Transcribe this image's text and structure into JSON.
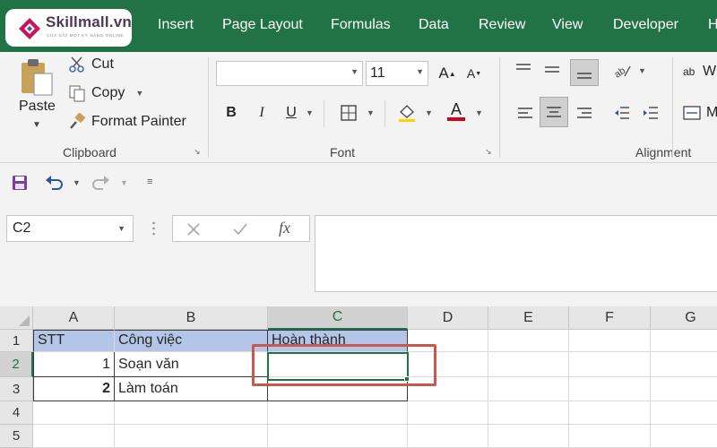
{
  "logo": {
    "name": "Skillmall.vn",
    "tagline": "CỬA GIỮ MỘT KỸ NĂNG ONLINE",
    "color": "#c2185b"
  },
  "ribbon_tabs": [
    "Insert",
    "Page Layout",
    "Formulas",
    "Data",
    "Review",
    "View",
    "Developer",
    "H"
  ],
  "clipboard": {
    "paste_label": "Paste",
    "cut_label": "Cut",
    "copy_label": "Copy",
    "format_painter_label": "Format Painter",
    "group_label": "Clipboard"
  },
  "font": {
    "font_name": "",
    "font_size": "11",
    "group_label": "Font",
    "bold": "B",
    "italic": "I",
    "underline": "U",
    "increase_size": "A",
    "decrease_size": "A",
    "font_color_letter": "A"
  },
  "alignment": {
    "group_label": "Alignment",
    "wrap_prefix": "ab",
    "wrap_label": "W",
    "merge_label": "M"
  },
  "name_box": "C2",
  "formula_value": "",
  "columns": [
    "A",
    "B",
    "C",
    "D",
    "E",
    "F",
    "G"
  ],
  "rows": [
    {
      "num": "1",
      "A": "STT",
      "B": "Công việc",
      "C": "Hoàn thành"
    },
    {
      "num": "2",
      "A": "1",
      "B": "Soạn văn",
      "C": ""
    },
    {
      "num": "3",
      "A": "2",
      "B": "Làm toán",
      "C": ""
    },
    {
      "num": "4",
      "A": "",
      "B": "",
      "C": ""
    },
    {
      "num": "5",
      "A": "",
      "B": "",
      "C": ""
    }
  ],
  "colors": {
    "excel_green": "#217346",
    "header_highlight": "#b4c6e7",
    "annotation_red": "#c8584e"
  }
}
